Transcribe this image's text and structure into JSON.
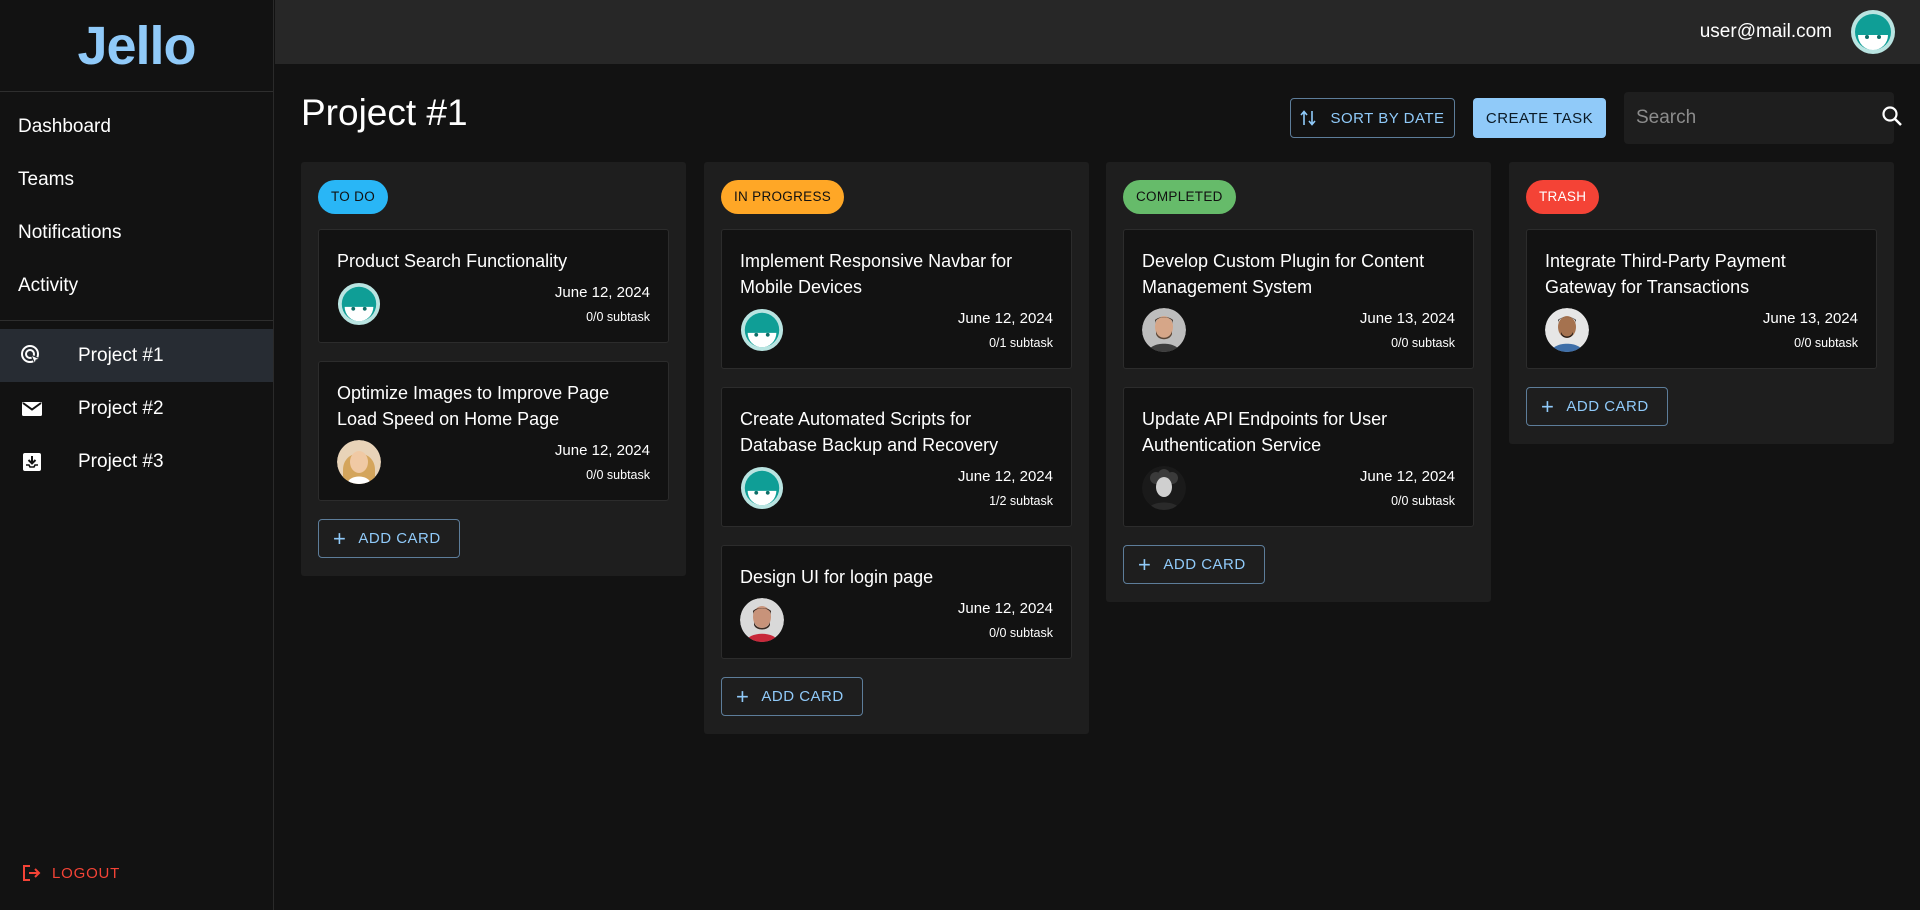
{
  "app": {
    "logo": "Jello"
  },
  "sidebar": {
    "nav": [
      {
        "label": "Dashboard"
      },
      {
        "label": "Teams"
      },
      {
        "label": "Notifications"
      },
      {
        "label": "Activity"
      }
    ],
    "projects": [
      {
        "label": "Project #1",
        "icon": "cursor-click-icon",
        "active": true
      },
      {
        "label": "Project #2",
        "icon": "mail-icon",
        "active": false
      },
      {
        "label": "Project #3",
        "icon": "inbox-download-icon",
        "active": false
      }
    ],
    "logout_label": "LOGOUT"
  },
  "topbar": {
    "user_email": "user@mail.com"
  },
  "header": {
    "title": "Project #1",
    "sort_label": "SORT BY DATE",
    "create_label": "CREATE TASK",
    "search_placeholder": "Search"
  },
  "columns": [
    {
      "status": "TO DO",
      "color": "#29b6f6",
      "add_label": "ADD CARD",
      "cards": [
        {
          "title": "Product Search Functionality",
          "date": "June 12, 2024",
          "subtask": "0/0 subtask",
          "avatar": "default-avatar"
        },
        {
          "title": "Optimize Images to Improve Page Load Speed on Home Page",
          "date": "June 12, 2024",
          "subtask": "0/0 subtask",
          "avatar": "woman-blonde-avatar"
        }
      ]
    },
    {
      "status": "IN PROGRESS",
      "color": "#ffa726",
      "add_label": "ADD CARD",
      "cards": [
        {
          "title": "Implement Responsive Navbar for Mobile Devices",
          "date": "June 12, 2024",
          "subtask": "0/1 subtask",
          "avatar": "default-avatar"
        },
        {
          "title": "Create Automated Scripts for Database Backup and Recovery",
          "date": "June 12, 2024",
          "subtask": "1/2 subtask",
          "avatar": "default-avatar"
        },
        {
          "title": "Design UI for login page",
          "date": "June 12, 2024",
          "subtask": "0/0 subtask",
          "avatar": "man-red-shirt-avatar"
        }
      ]
    },
    {
      "status": "COMPLETED",
      "color": "#66bb6a",
      "add_label": "ADD CARD",
      "cards": [
        {
          "title": "Develop Custom Plugin for Content Management System",
          "date": "June 13, 2024",
          "subtask": "0/0 subtask",
          "avatar": "man-beard-avatar"
        },
        {
          "title": "Update API Endpoints for User Authentication Service",
          "date": "June 12, 2024",
          "subtask": "0/0 subtask",
          "avatar": "man-curly-avatar"
        }
      ]
    },
    {
      "status": "TRASH",
      "color": "#f44336",
      "add_label": "ADD CARD",
      "cards": [
        {
          "title": "Integrate Third-Party Payment Gateway for Transactions",
          "date": "June 13, 2024",
          "subtask": "0/0 subtask",
          "avatar": "man-smiling-avatar"
        }
      ]
    }
  ]
}
